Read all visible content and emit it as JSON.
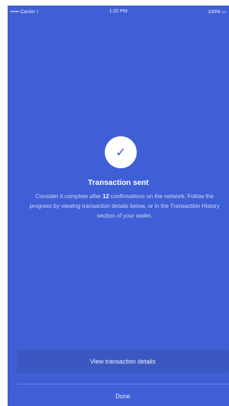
{
  "status_bar": {
    "carrier": "••••• Carrier",
    "wifi_icon": "wifi-icon",
    "time": "1:20 PM",
    "battery": "100%",
    "battery_icon": "battery-icon"
  },
  "success": {
    "icon": "checkmark-icon",
    "title": "Transaction sent",
    "message_before": "Consider it complete after ",
    "confirmations": "12",
    "message_after": " confirmations on the network. Follow the progress by viewing transaction details below, or in the Transaction History section of your wallet."
  },
  "actions": {
    "view_details": "View transaction details",
    "done": "Done"
  },
  "colors": {
    "background": "#3e5fd6",
    "button": "#3b58c2",
    "text": "#ffffff"
  }
}
